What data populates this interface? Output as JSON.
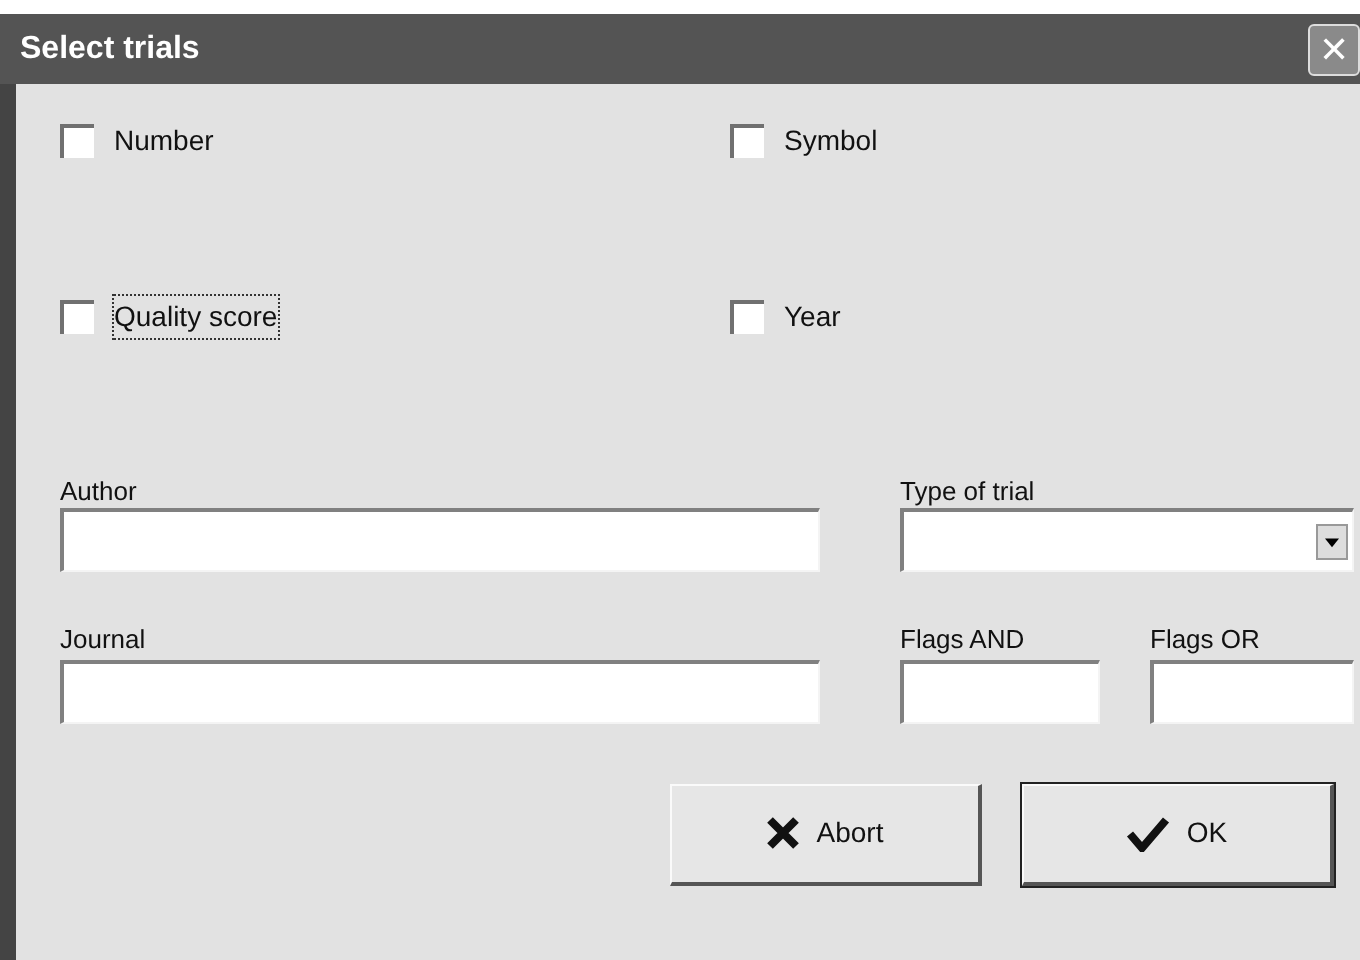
{
  "window": {
    "title": "Select trials",
    "close_label": "✕"
  },
  "checkboxes": [
    {
      "label": "Number",
      "checked": false,
      "focused": false
    },
    {
      "label": "Symbol",
      "checked": false,
      "focused": false
    },
    {
      "label": "Quality score",
      "checked": false,
      "focused": true
    },
    {
      "label": "Year",
      "checked": false,
      "focused": false
    }
  ],
  "author": {
    "label": "Author"
  },
  "type_of_trial": {
    "label": "Type of trial"
  },
  "journal": {
    "label": "Journal"
  },
  "flags_and": {
    "label": "Flags AND"
  },
  "flags_or": {
    "label": "Flags OR"
  },
  "buttons": [
    {
      "kind": "abort",
      "label": "Abort"
    },
    {
      "kind": "ok",
      "label": "OK"
    }
  ]
}
